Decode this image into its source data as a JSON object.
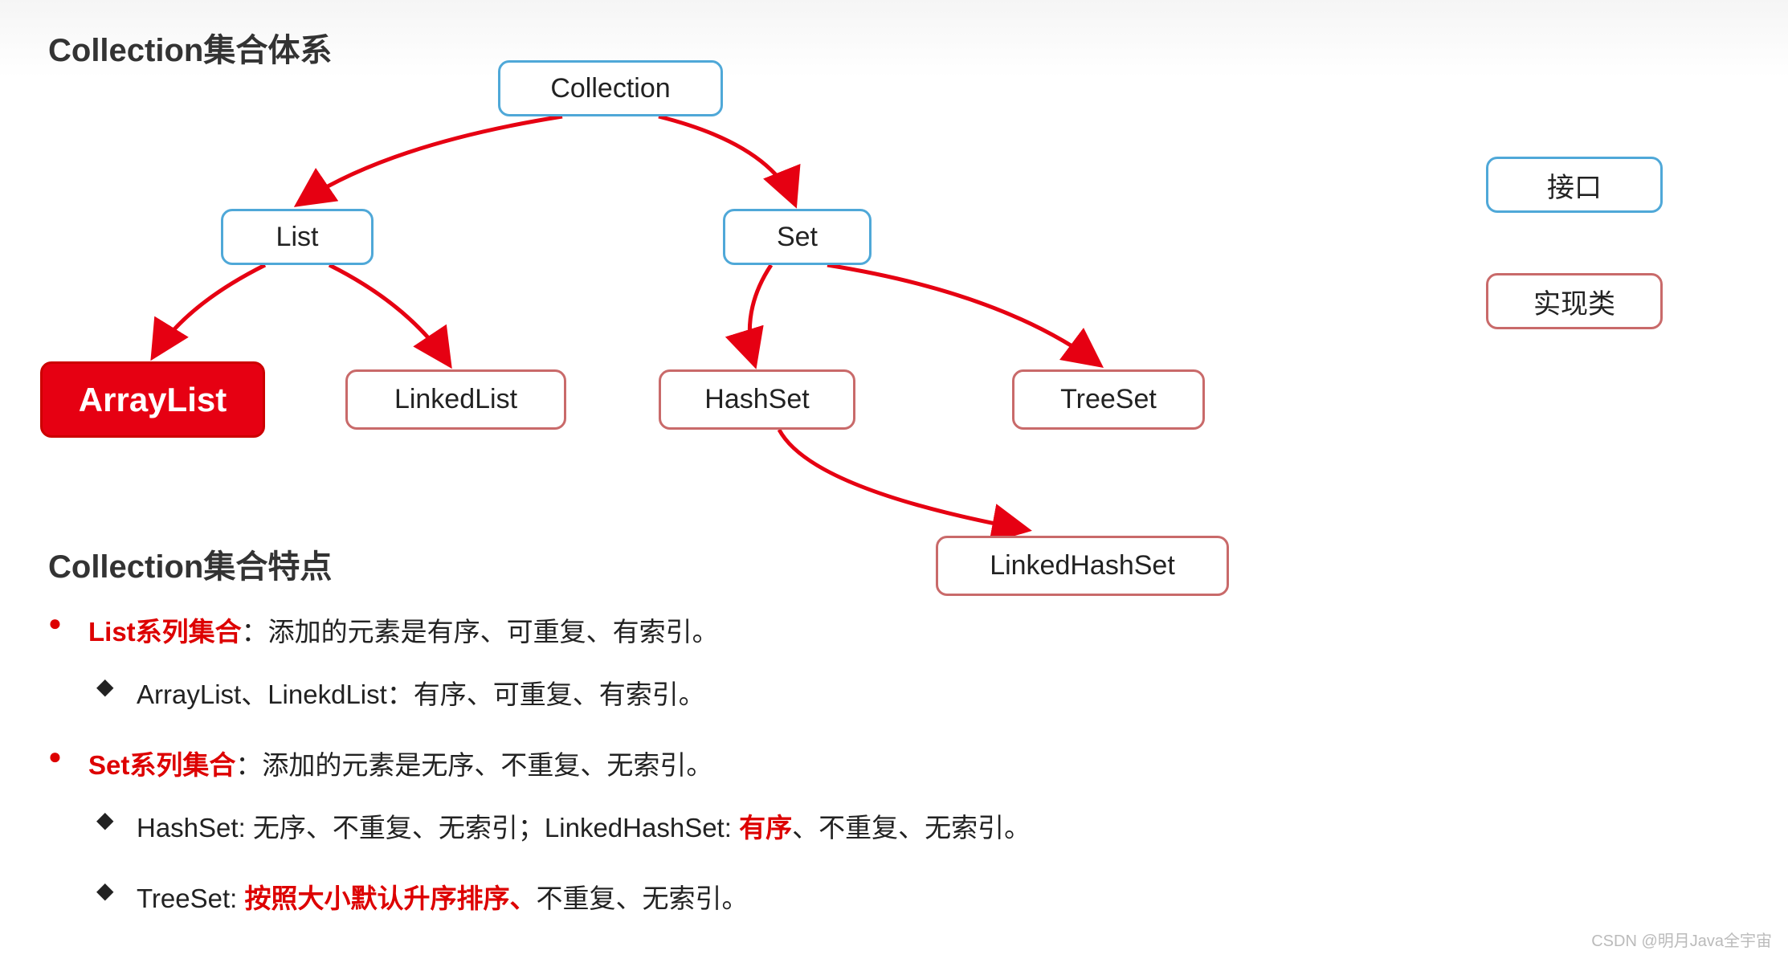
{
  "titles": {
    "main": "Collection集合体系",
    "section": "Collection集合特点"
  },
  "nodes": {
    "collection": "Collection",
    "list": "List",
    "set": "Set",
    "arraylist": "ArrayList",
    "linkedlist": "LinkedList",
    "hashset": "HashSet",
    "treeset": "TreeSet",
    "linkedhashset": "LinkedHashSet"
  },
  "legend": {
    "interface": "接口",
    "impl": "实现类"
  },
  "features": {
    "list": {
      "label": "List系列集合",
      "desc": "：添加的元素是有序、可重复、有索引。",
      "sub": "ArrayList、LinekdList：有序、可重复、有索引。"
    },
    "set": {
      "label": "Set系列集合",
      "desc": "：添加的元素是无序、不重复、无索引。",
      "sub1_pre": "HashSet: 无序、不重复、无索引；LinkedHashSet: ",
      "sub1_em": "有序",
      "sub1_post": "、不重复、无索引。",
      "sub2_pre": "TreeSet: ",
      "sub2_em": "按照大小默认升序排序、",
      "sub2_post": "不重复、无索引。"
    }
  },
  "watermark": "CSDN @明月Java全宇宙",
  "colors": {
    "arrow": "#e60012",
    "interface_border": "#4fa8d8",
    "impl_border": "#c96a6a"
  }
}
